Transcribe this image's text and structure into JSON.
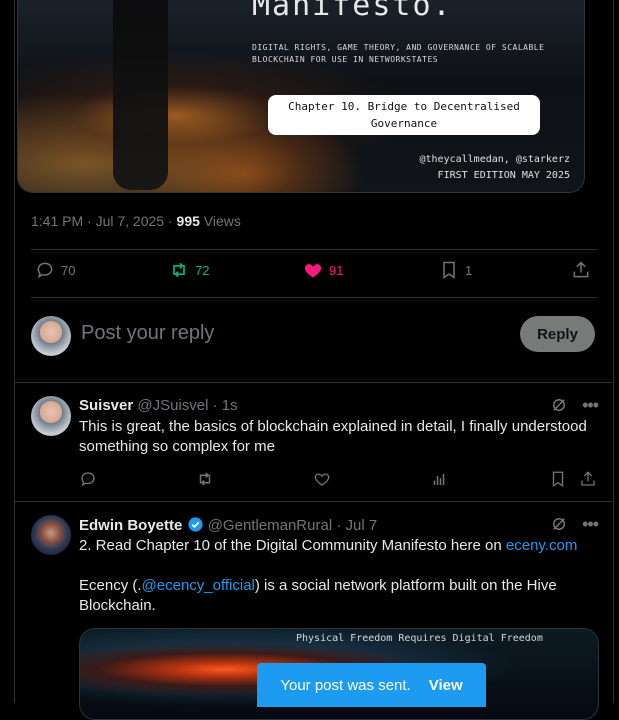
{
  "hero": {
    "title": "Manifesto.",
    "subtitle": "DIGITAL RIGHTS, GAME THEORY, AND GOVERNANCE OF SCALABLE BLOCKCHAIN FOR USE IN NETWORKSTATES",
    "chapter_line1": "Chapter 10. Bridge to Decentralised",
    "chapter_line2": "Governance",
    "authors": "@theycallmedan, @starkerz",
    "edition": "FIRST EDITION MAY 2025"
  },
  "post_meta": {
    "time": "1:41 PM · Jul 7, 2025 · ",
    "views_count": "995",
    "views_label": " Views"
  },
  "actions": {
    "replies": "70",
    "reposts": "72",
    "likes": "91",
    "bookmarks": "1"
  },
  "composer": {
    "placeholder": "Post your reply",
    "reply_label": "Reply"
  },
  "replies": [
    {
      "name": "Suisver",
      "handle": "@JSuisvel · 1s",
      "text": "This is great, the basics of blockchain explained in detail, I finally understood something so complex for me"
    },
    {
      "name": "Edwin Boyette",
      "handle": "@GentlemanRural · Jul 7",
      "line1_prefix": "2.  Read Chapter 10 of the Digital Community Manifesto here on ",
      "line1_link": "eceny.com",
      "p2_a": "Ecency (.",
      "p2_link": "@ecency_official",
      "p2_b": ")  is a social network platform built on the Hive Blockchain.",
      "card_caption": "Physical Freedom Requires Digital Freedom"
    }
  ],
  "toast": {
    "text": "Your post was sent.",
    "action": "View"
  },
  "colors": {
    "accent": "#1d9bf0",
    "repost": "#00ba7c",
    "like": "#f91880",
    "muted": "#71767b",
    "verified": "#1d9bf0"
  }
}
